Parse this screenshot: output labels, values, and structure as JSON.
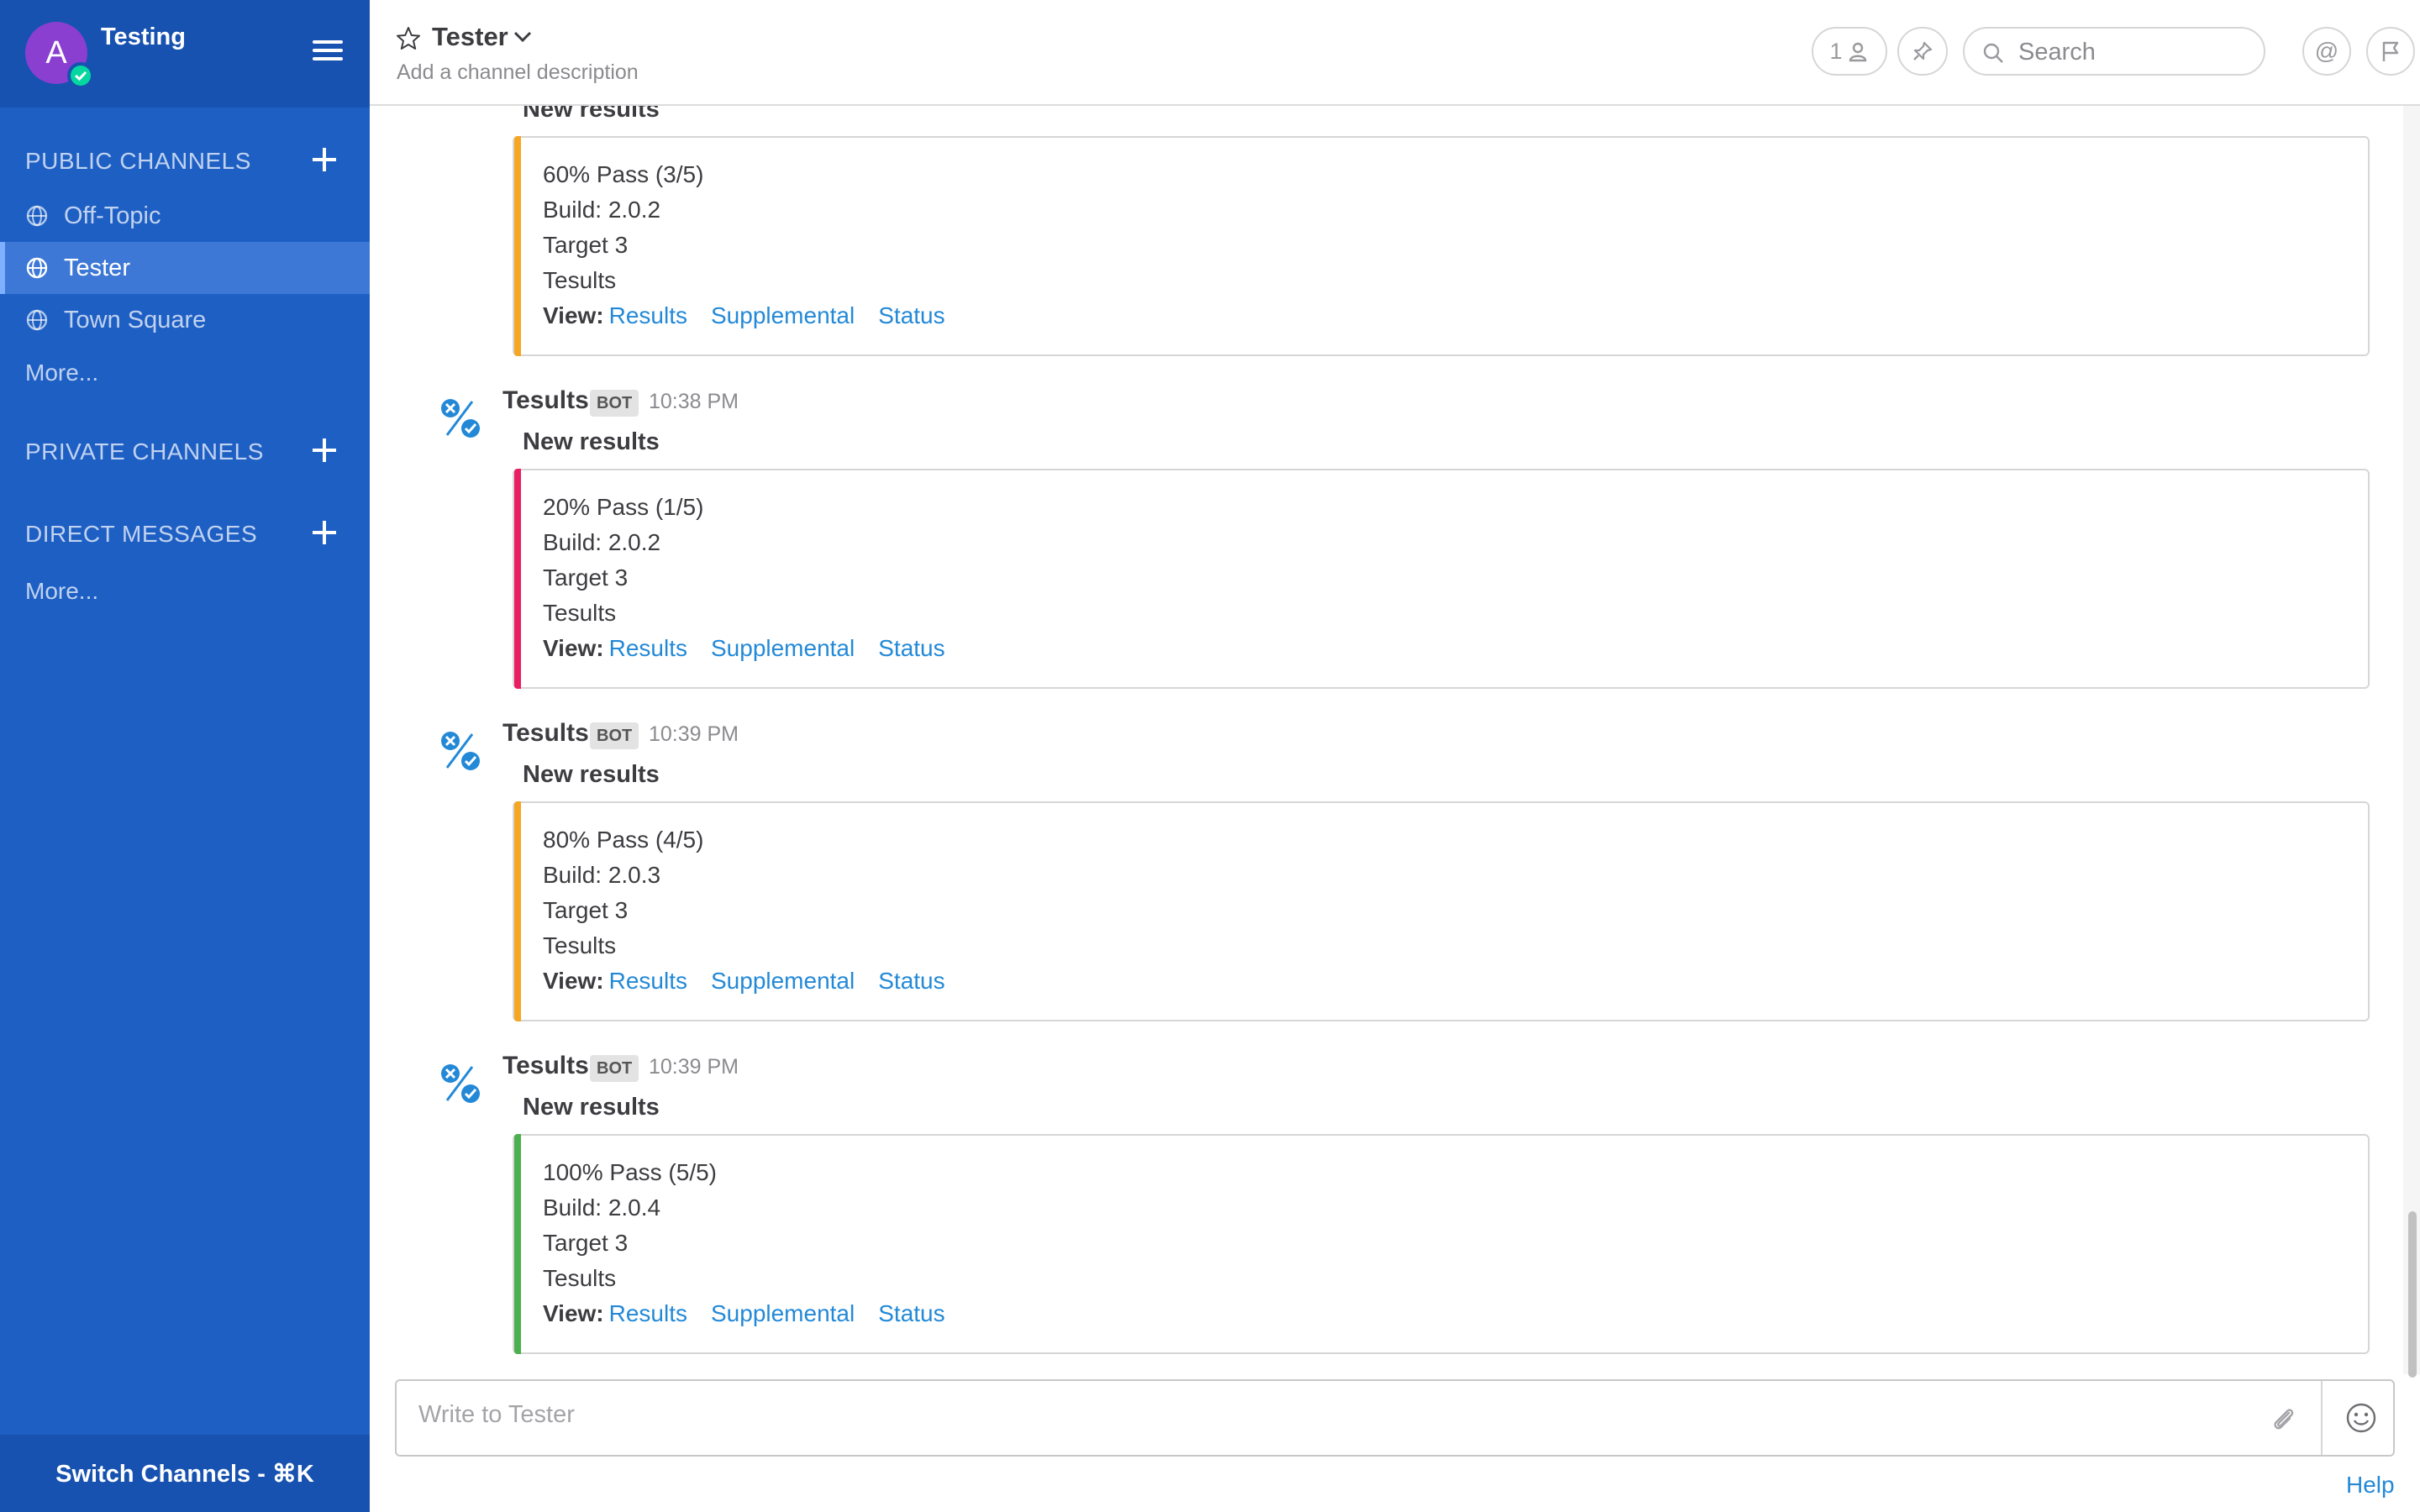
{
  "sidebar": {
    "team_name": "Testing",
    "avatar_initial": "A",
    "public_channels_title": "PUBLIC CHANNELS",
    "public_channels": [
      {
        "label": "Off-Topic"
      },
      {
        "label": "Tester"
      },
      {
        "label": "Town Square"
      }
    ],
    "public_more": "More...",
    "private_channels_title": "PRIVATE CHANNELS",
    "direct_messages_title": "DIRECT MESSAGES",
    "dm_more": "More...",
    "switch_channels": "Switch Channels - ⌘K"
  },
  "header": {
    "channel_name": "Tester",
    "channel_description": "Add a channel description",
    "member_count": "1",
    "search_placeholder": "Search",
    "at_label": "@"
  },
  "top_partial": {
    "pretext": "New results",
    "lines": [
      "60% Pass (3/5)",
      "Build: 2.0.2",
      "Target 3",
      "Tesults"
    ],
    "view_label": "View:",
    "links": [
      "Results",
      "Supplemental",
      "Status"
    ],
    "color": "#f5a623"
  },
  "posts": [
    {
      "username": "Tesults",
      "badge": "BOT",
      "time": "10:38 PM",
      "pretext": "New results",
      "lines": [
        "20% Pass (1/5)",
        "Build: 2.0.2",
        "Target 3",
        "Tesults"
      ],
      "view_label": "View:",
      "links": [
        "Results",
        "Supplemental",
        "Status"
      ],
      "color": "#e91e63"
    },
    {
      "username": "Tesults",
      "badge": "BOT",
      "time": "10:39 PM",
      "pretext": "New results",
      "lines": [
        "80% Pass (4/5)",
        "Build: 2.0.3",
        "Target 3",
        "Tesults"
      ],
      "view_label": "View:",
      "links": [
        "Results",
        "Supplemental",
        "Status"
      ],
      "color": "#f5a623"
    },
    {
      "username": "Tesults",
      "badge": "BOT",
      "time": "10:39 PM",
      "pretext": "New results",
      "lines": [
        "100% Pass (5/5)",
        "Build: 2.0.4",
        "Target 3",
        "Tesults"
      ],
      "view_label": "View:",
      "links": [
        "Results",
        "Supplemental",
        "Status"
      ],
      "color": "#4caf50"
    }
  ],
  "composer": {
    "placeholder": "Write to Tester",
    "help": "Help"
  }
}
